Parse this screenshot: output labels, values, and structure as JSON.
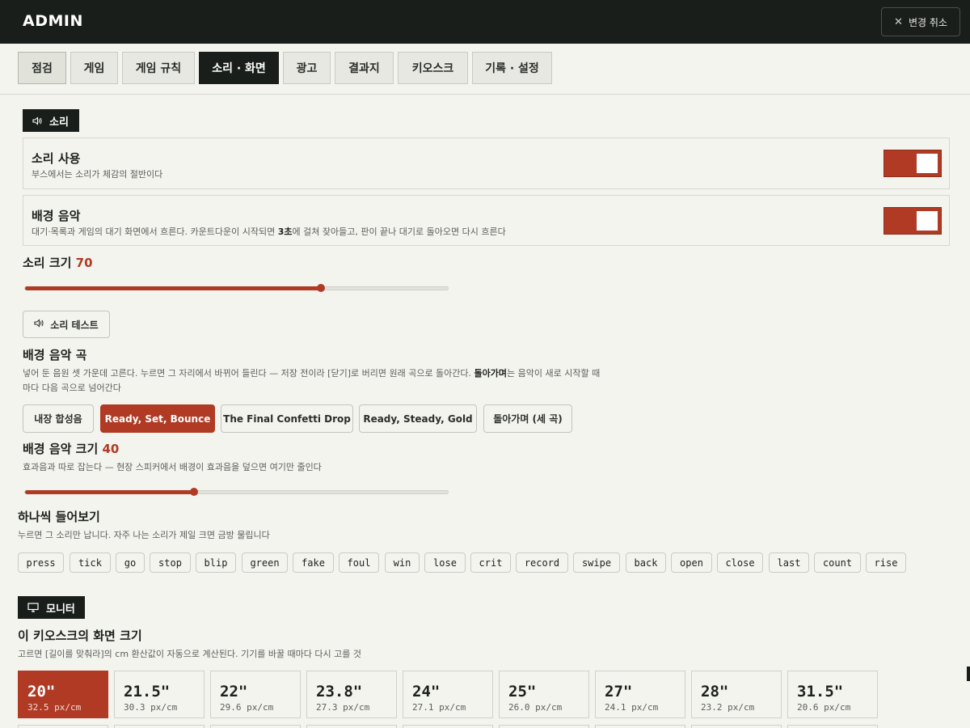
{
  "header": {
    "brand": "ADMIN",
    "revert_label": "변경 취소"
  },
  "tabs": [
    "점검",
    "게임",
    "게임 규칙",
    "소리 · 화면",
    "광고",
    "결과지",
    "키오스크",
    "기록 · 설정"
  ],
  "active_tab": "소리 · 화면",
  "sound": {
    "section_label": "소리",
    "enable": {
      "title": "소리 사용",
      "desc": "부스에서는 소리가 체감의 절반이다",
      "on": true
    },
    "bgm": {
      "title": "배경 음악",
      "desc_pre": "대기·목록과 게임의 대기 화면에서 흐른다. 카운트다운이 시작되면 ",
      "desc_bold": "3초",
      "desc_post": "에 걸쳐 잦아들고, 판이 끝나 대기로 돌아오면 다시 흐른다",
      "on": true
    },
    "volume": {
      "label": "소리 크기",
      "value": "70",
      "level": 70
    },
    "test_label": "소리 테스트",
    "track": {
      "title": "배경 음악 곡",
      "desc_pre": "넣어 둔 음원 셋 가운데 고른다. 누르면 그 자리에서 바뀌어 들린다 — 저장 전이라 [닫기]로 버리면 원래 곡으로 돌아간다. ",
      "desc_bold": "돌아가며",
      "desc_post": "는 음악이 새로 시작할 때마다 다음 곡으로 넘어간다",
      "options": [
        "내장 합성음",
        "Ready, Set, Bounce",
        "The Final Confetti Drop",
        "Ready, Steady, Gold",
        "돌아가며 (세 곡)"
      ],
      "selected": "Ready, Set, Bounce"
    },
    "bgm_volume": {
      "label": "배경 음악 크기",
      "value": "40",
      "level": 40,
      "desc": "효과음과 따로 잡는다 — 현장 스피커에서 배경이 효과음을 덮으면 여기만 줄인다"
    },
    "preview": {
      "title": "하나씩 들어보기",
      "desc": "누르면 그 소리만 납니다. 자주 나는 소리가 제일 크면 금방 물립니다",
      "sounds": [
        "press",
        "tick",
        "go",
        "stop",
        "blip",
        "green",
        "fake",
        "foul",
        "win",
        "lose",
        "crit",
        "record",
        "swipe",
        "back",
        "open",
        "close",
        "last",
        "count",
        "rise"
      ]
    }
  },
  "monitor": {
    "section_label": "모니터",
    "title": "이 키오스크의 화면 크기",
    "desc": "고르면 [길이를 맞춰라]의 cm 환산값이 자동으로 계산된다. 기기를 바꿀 때마다 다시 고를 것",
    "sizes": [
      {
        "size": "20\"",
        "density": "32.5 px/cm"
      },
      {
        "size": "21.5\"",
        "density": "30.3 px/cm"
      },
      {
        "size": "22\"",
        "density": "29.6 px/cm"
      },
      {
        "size": "23.8\"",
        "density": "27.3 px/cm"
      },
      {
        "size": "24\"",
        "density": "27.1 px/cm"
      },
      {
        "size": "25\"",
        "density": "26.0 px/cm"
      },
      {
        "size": "27\"",
        "density": "24.1 px/cm"
      },
      {
        "size": "28\"",
        "density": "23.2 px/cm"
      },
      {
        "size": "31.5\"",
        "density": "20.6 px/cm"
      }
    ],
    "selected_size": "20\""
  },
  "icons": {
    "revert": "close-icon",
    "sound": "speaker-icon",
    "monitor": "monitor-icon"
  },
  "colors": {
    "accent": "#b03a24",
    "dark": "#1a1e1b",
    "background": "#f4f4ef"
  }
}
